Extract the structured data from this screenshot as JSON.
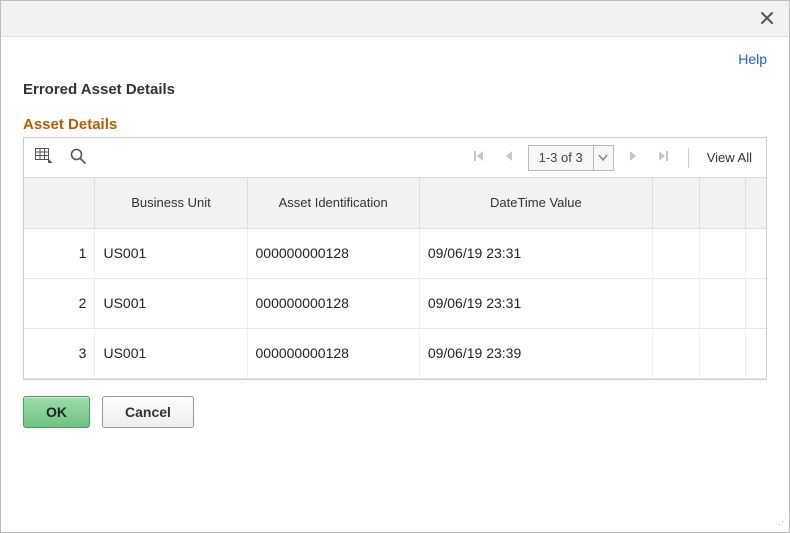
{
  "header": {
    "help_label": "Help"
  },
  "page": {
    "title": "Errored Asset Details"
  },
  "section": {
    "title": "Asset Details"
  },
  "grid": {
    "range_text": "1-3 of 3",
    "view_all_label": "View All",
    "columns": {
      "business_unit": "Business Unit",
      "asset_id": "Asset Identification",
      "datetime": "DateTime Value"
    },
    "rows": [
      {
        "num": "1",
        "business_unit": "US001",
        "asset_id": "000000000128",
        "datetime": "09/06/19 23:31"
      },
      {
        "num": "2",
        "business_unit": "US001",
        "asset_id": "000000000128",
        "datetime": "09/06/19 23:31"
      },
      {
        "num": "3",
        "business_unit": "US001",
        "asset_id": "000000000128",
        "datetime": "09/06/19 23:39"
      }
    ]
  },
  "buttons": {
    "ok": "OK",
    "cancel": "Cancel"
  }
}
